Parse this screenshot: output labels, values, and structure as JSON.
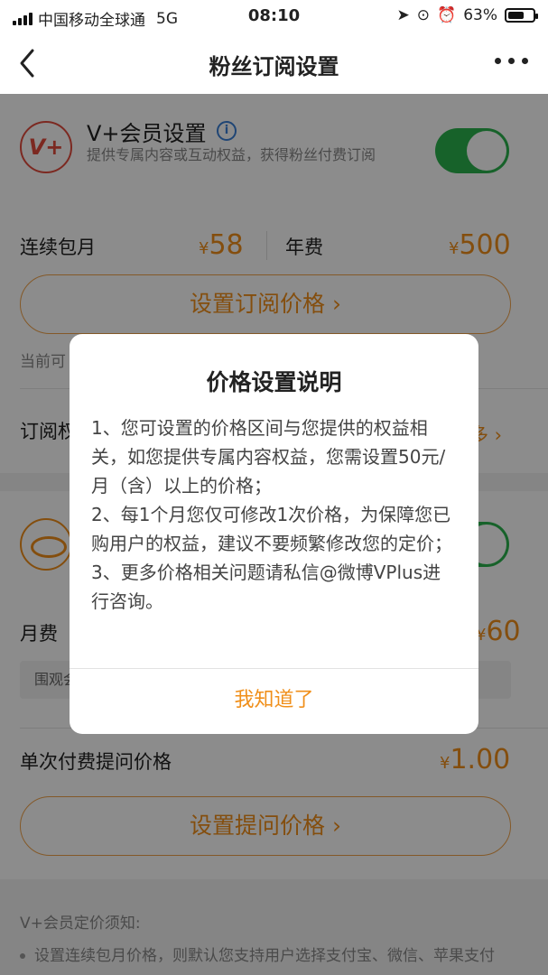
{
  "status_bar": {
    "carrier": "中国移动全球通",
    "network": "5G",
    "time": "08:10",
    "battery": "63%",
    "battery_level": 0.63
  },
  "nav": {
    "title": "粉丝订阅设置",
    "back_icon": "chevron-left-icon",
    "more_icon": "more-icon"
  },
  "vplus": {
    "title": "V+会员设置",
    "subtitle": "提供专属内容或互动权益，获得粉丝付费订阅",
    "toggle_on": true,
    "monthly_label": "连续包月",
    "monthly_price": "58",
    "annual_label": "年费",
    "annual_price": "500",
    "currency": "¥",
    "set_price_button": "设置订阅价格",
    "current_text": "当前可",
    "subscribe_row": "订阅权",
    "more_link": "多"
  },
  "watch": {
    "monthly_label": "月费",
    "monthly_price": "60",
    "tag_text": "围观会",
    "toggle_on": true
  },
  "question": {
    "label": "单次付费提问价格",
    "price": "1.00",
    "set_button": "设置提问价格"
  },
  "notice": {
    "title": "V+会员定价须知:",
    "item1": "设置连续包月价格，则默认您支持用户选择支付宝、微信、苹果支付"
  },
  "dialog": {
    "title": "价格设置说明",
    "line1": "1、您可设置的价格区间与您提供的权益相关，如您提供专属内容权益，您需设置50元/月（含）以上的价格；",
    "line2": "2、每1个月您仅可修改1次价格，为保障您已购用户的权益，建议不要频繁修改您的定价；",
    "line3": "3、更多价格相关问题请私信@微博VPlus进行咨询。",
    "confirm_button": "我知道了"
  },
  "colors": {
    "accent": "#f08f1a",
    "toggle_green": "#2bb34d",
    "brand_red": "#e24b3d"
  }
}
